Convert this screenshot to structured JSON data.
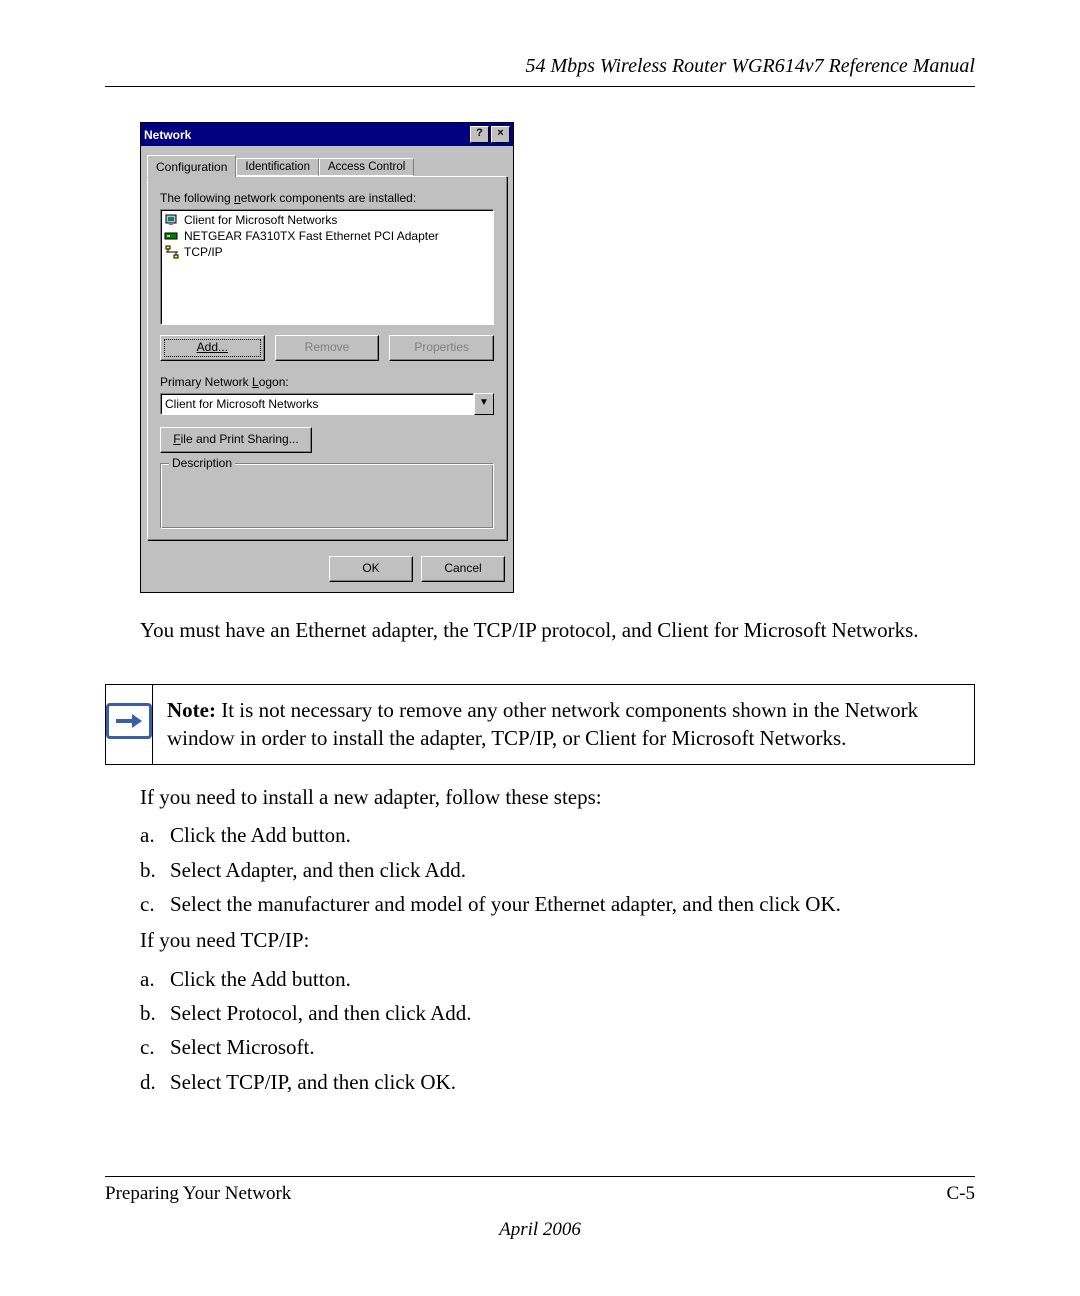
{
  "header": {
    "running_title": "54 Mbps Wireless Router WGR614v7 Reference Manual"
  },
  "dialog": {
    "title": "Network",
    "help_glyph": "?",
    "close_glyph": "×",
    "tabs": [
      "Configuration",
      "Identification",
      "Access Control"
    ],
    "components_label_pre": "The following ",
    "components_label_und": "n",
    "components_label_post": "etwork components are installed:",
    "components": [
      "Client for Microsoft Networks",
      "NETGEAR FA310TX Fast Ethernet PCI Adapter",
      "TCP/IP"
    ],
    "buttons": {
      "add": "Add...",
      "remove": "Remove",
      "properties": "Properties"
    },
    "logon_label_pre": "Primary Network ",
    "logon_label_und": "L",
    "logon_label_post": "ogon:",
    "logon_value": "Client for Microsoft Networks",
    "file_print_und": "F",
    "file_print_rest": "ile and Print Sharing...",
    "description_label": "Description",
    "ok": "OK",
    "cancel": "Cancel"
  },
  "body": {
    "para1": "You must have an Ethernet adapter, the TCP/IP protocol, and Client for Microsoft Networks.",
    "note_label": "Note:",
    "note_text": " It is not necessary to remove any other network components shown in the Network window in order to install the adapter, TCP/IP, or Client for Microsoft Networks.",
    "adapter_intro": "If you need to install a new adapter, follow these steps:",
    "adapter_steps": [
      "Click the Add button.",
      "Select Adapter, and then click Add.",
      "Select the manufacturer and model of your Ethernet adapter, and then click OK."
    ],
    "tcpip_intro": "If you need TCP/IP:",
    "tcpip_steps": [
      "Click the Add button.",
      "Select Protocol, and then click Add.",
      "Select Microsoft.",
      "Select TCP/IP, and then click OK."
    ],
    "markers": [
      "a.",
      "b.",
      "c.",
      "d."
    ]
  },
  "footer": {
    "section": "Preparing Your Network",
    "page": "C-5",
    "date": "April 2006"
  }
}
